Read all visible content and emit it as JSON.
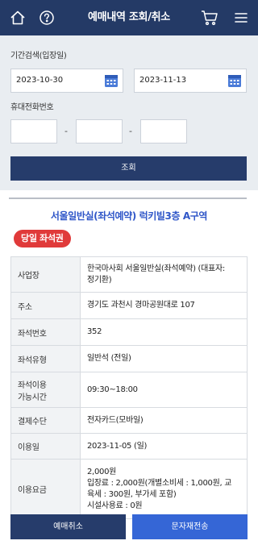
{
  "header": {
    "title": "예매내역 조회/취소",
    "home_icon": "home-icon",
    "help_icon": "help-icon",
    "cart_icon": "cart-icon",
    "menu_icon": "menu-icon"
  },
  "search": {
    "period_label": "기간검색(입장일)",
    "start_date": "2023-10-30",
    "end_date": "2023-11-13",
    "phone_label": "휴대전화번호",
    "phone_part1": "",
    "phone_part2": "",
    "phone_part3": "",
    "separator": "-",
    "submit_label": "조회"
  },
  "booking": {
    "venue_title": "서울일반실(좌석예약) 럭키빌3층 A구역",
    "badge": "당일 좌석권",
    "rows": [
      {
        "key": "사업장",
        "value_lines": [
          "한국마사회 서울일반실(좌석예약) (대표자:",
          "정기환)"
        ]
      },
      {
        "key": "주소",
        "value_lines": [
          "경기도 과천시 경마공원대로 107"
        ]
      },
      {
        "key": "좌석번호",
        "value_lines": [
          "352"
        ]
      },
      {
        "key": "좌석유형",
        "value_lines": [
          "일반석 (전일)"
        ]
      },
      {
        "key_lines": [
          "좌석이용",
          "가능시간"
        ],
        "value_lines": [
          "09:30~18:00"
        ]
      },
      {
        "key": "결제수단",
        "value_lines": [
          "전자카드(모바일)"
        ]
      },
      {
        "key": "이용일",
        "value_lines": [
          "2023-11-05 (일)"
        ]
      },
      {
        "key": "이용요금",
        "value_lines": [
          "2,000원",
          "입장료 : 2,000원(개별소비세 : 1,000원, 교",
          "육세 : 300원, 부가세 포함)",
          "시설사용료 : 0원"
        ]
      }
    ]
  },
  "actions": {
    "cancel_label": "예매취소",
    "resend_label": "문자재전송"
  },
  "colors": {
    "header_bg": "#243a66",
    "primary": "#263c6b",
    "accent_blue": "#3566d6",
    "title_blue": "#2f56c8",
    "badge_red": "#e03a3a",
    "search_bg": "#e9edf1"
  }
}
